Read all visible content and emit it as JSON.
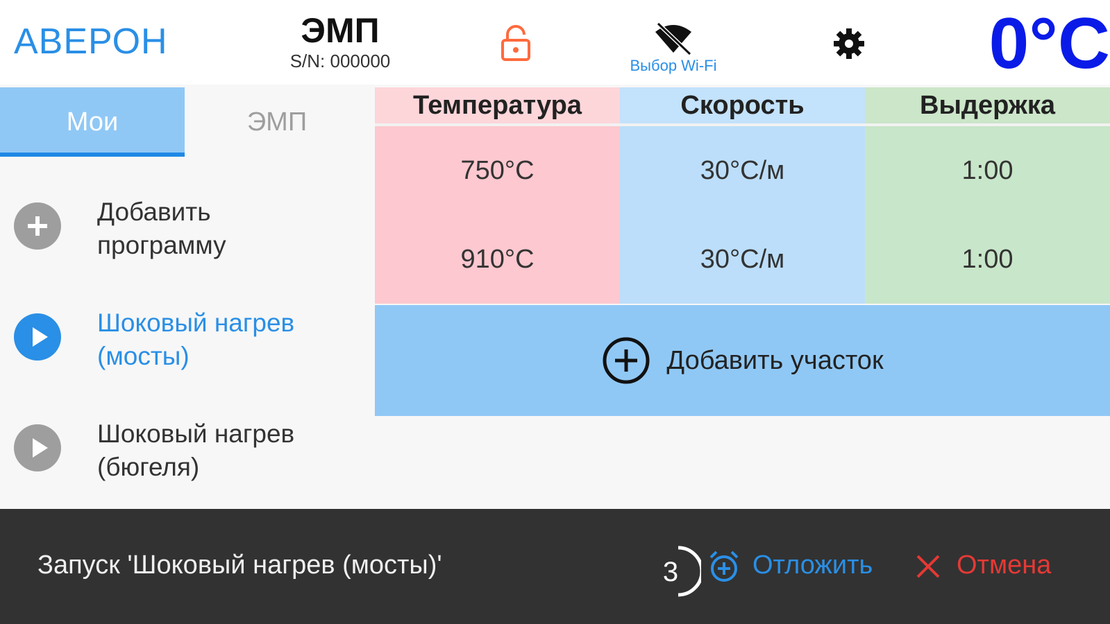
{
  "header": {
    "brand": "АВЕРОН",
    "device_name": "ЭМП",
    "serial": "S/N: 000000",
    "wifi_label": "Выбор Wi-Fi",
    "temperature": "0°C",
    "icons": [
      "lock-open-icon",
      "wifi-off-icon",
      "gear-icon"
    ]
  },
  "sidebar": {
    "tabs": [
      {
        "label": "Мои",
        "active": true
      },
      {
        "label": "ЭМП",
        "active": false
      }
    ],
    "items": [
      {
        "line1": "Добавить",
        "line2": "программу",
        "icon": "add-icon"
      },
      {
        "line1": "Шоковый нагрев",
        "line2": "(мосты)",
        "icon": "play-icon",
        "selected": true
      },
      {
        "line1": "Шоковый нагрев",
        "line2": "(бюгеля)",
        "icon": "play-icon"
      }
    ]
  },
  "table": {
    "headers": {
      "temperature": "Температура",
      "speed": "Скорость",
      "hold": "Выдержка"
    },
    "rows": [
      {
        "temperature": "750°C",
        "speed": "30°C/м",
        "hold": "1:00"
      },
      {
        "temperature": "910°C",
        "speed": "30°C/м",
        "hold": "1:00"
      }
    ],
    "add_section_label": "Добавить участок"
  },
  "snackbar": {
    "message": "Запуск 'Шоковый нагрев (мосты)'",
    "countdown": "3",
    "postpone_label": "Отложить",
    "cancel_label": "Отмена"
  },
  "colors": {
    "accent": "#2a8fe6",
    "temperature": "#0a1be8",
    "lock": "#ff6a3d",
    "cancel": "#e53935",
    "temp_col": "#fdc8cf",
    "speed_col": "#bcdefa",
    "hold_col": "#c8e6c9"
  }
}
